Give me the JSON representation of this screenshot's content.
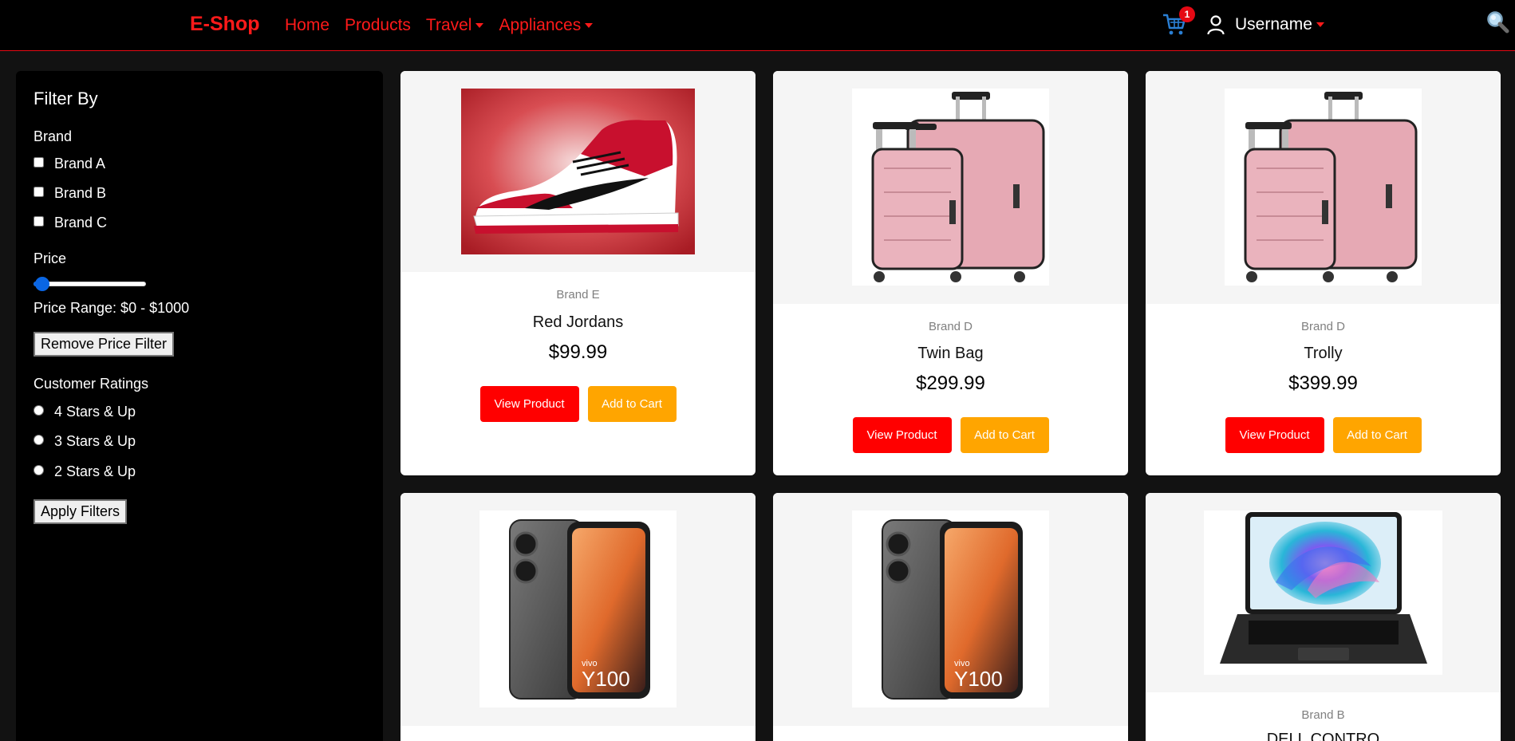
{
  "navbar": {
    "brand": "E-Shop",
    "links": [
      {
        "label": "Home",
        "dropdown": false
      },
      {
        "label": "Products",
        "dropdown": false
      },
      {
        "label": "Travel",
        "dropdown": true
      },
      {
        "label": "Appliances",
        "dropdown": true
      }
    ],
    "cart_count": "1",
    "username": "Username",
    "accent_color": "#ff1a1a"
  },
  "sidebar": {
    "title": "Filter By",
    "brand_label": "Brand",
    "brands": [
      "Brand A",
      "Brand B",
      "Brand C"
    ],
    "price_label": "Price",
    "price_slider_value": 0,
    "price_range_text": "Price Range: $0 - $1000",
    "remove_price_filter": "Remove Price Filter",
    "ratings_label": "Customer Ratings",
    "ratings": [
      "4 Stars & Up",
      "3 Stars & Up",
      "2 Stars & Up"
    ],
    "apply_filters": "Apply Filters"
  },
  "products": [
    {
      "brand": "Brand E",
      "name": "Red Jordans",
      "price": "$99.99",
      "image": "sneaker-image",
      "view_label": "View Product",
      "cart_label": "Add to Cart"
    },
    {
      "brand": "Brand D",
      "name": "Twin Bag",
      "price": "$299.99",
      "image": "luggage-image",
      "view_label": "View Product",
      "cart_label": "Add to Cart"
    },
    {
      "brand": "Brand D",
      "name": "Trolly",
      "price": "$399.99",
      "image": "luggage-image",
      "view_label": "View Product",
      "cart_label": "Add to Cart"
    },
    {
      "brand": "",
      "name": "",
      "price": "",
      "image": "phone-image",
      "phone_model": "Y100",
      "phone_brand": "vivo"
    },
    {
      "brand": "",
      "name": "",
      "price": "",
      "image": "phone-image",
      "phone_model": "Y100",
      "phone_brand": "vivo"
    },
    {
      "brand": "Brand B",
      "name": "DELL CONTRO",
      "price": "",
      "image": "laptop-image"
    }
  ],
  "colors": {
    "view_button": "#ff0000",
    "cart_button": "#ffa500",
    "slider": "#0a66e4"
  }
}
